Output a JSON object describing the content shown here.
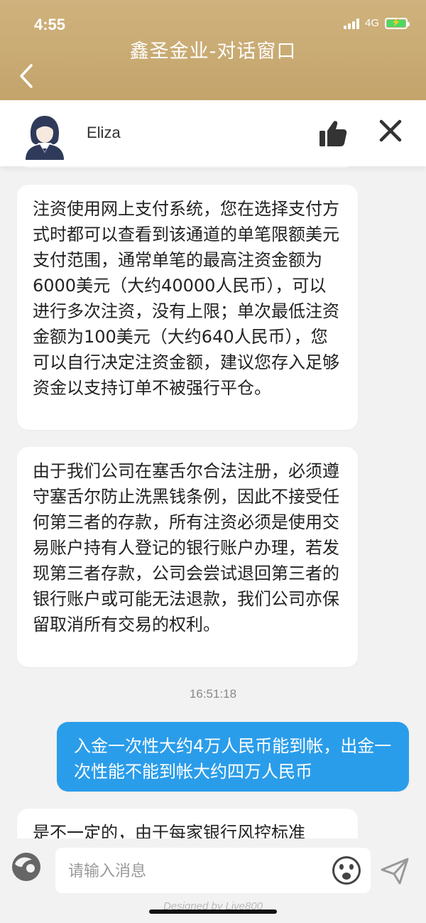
{
  "status_bar": {
    "time": "4:55",
    "network": "4G"
  },
  "header": {
    "title": "鑫圣金业-对话窗口"
  },
  "agent": {
    "name": "Eliza"
  },
  "messages": [
    {
      "sender": "agent",
      "text": "注资使用网上支付系统，您在选择支付方式时都可以查看到该通道的单笔限额美元支付范围，通常单笔的最高注资金额为6000美元（大约40000人民币），可以进行多次注资，没有上限；单次最低注资金额为100美元（大约640人民币），您可以自行决定注资金额，建议您存入足够资金以支持订单不被强行平仓。"
    },
    {
      "sender": "agent",
      "text": "由于我们公司在塞舌尔合法注册，必须遵守塞舌尔防止洗黑钱条例，因此不接受任何第三者的存款，所有注资必须是使用交易账户持有人登记的银行账户办理，若发现第三者存款，公司会尝试退回第三者的银行账户或可能无法退款，我们公司亦保留取消所有交易的权利。"
    },
    {
      "sender": "user",
      "time": "16:51:18",
      "text": "入金一次性大约4万人民币能到帐，出金一次性能不能到帐大约四万人民币"
    },
    {
      "sender": "agent",
      "text": "是不一定的，由于每家银行风控标准"
    }
  ],
  "input": {
    "placeholder": "请输入消息",
    "value": ""
  },
  "footer": {
    "text": "Designed by Live800"
  },
  "colors": {
    "header": "#c7a970",
    "user_bubble": "#2a9dea",
    "battery": "#4cd964"
  }
}
